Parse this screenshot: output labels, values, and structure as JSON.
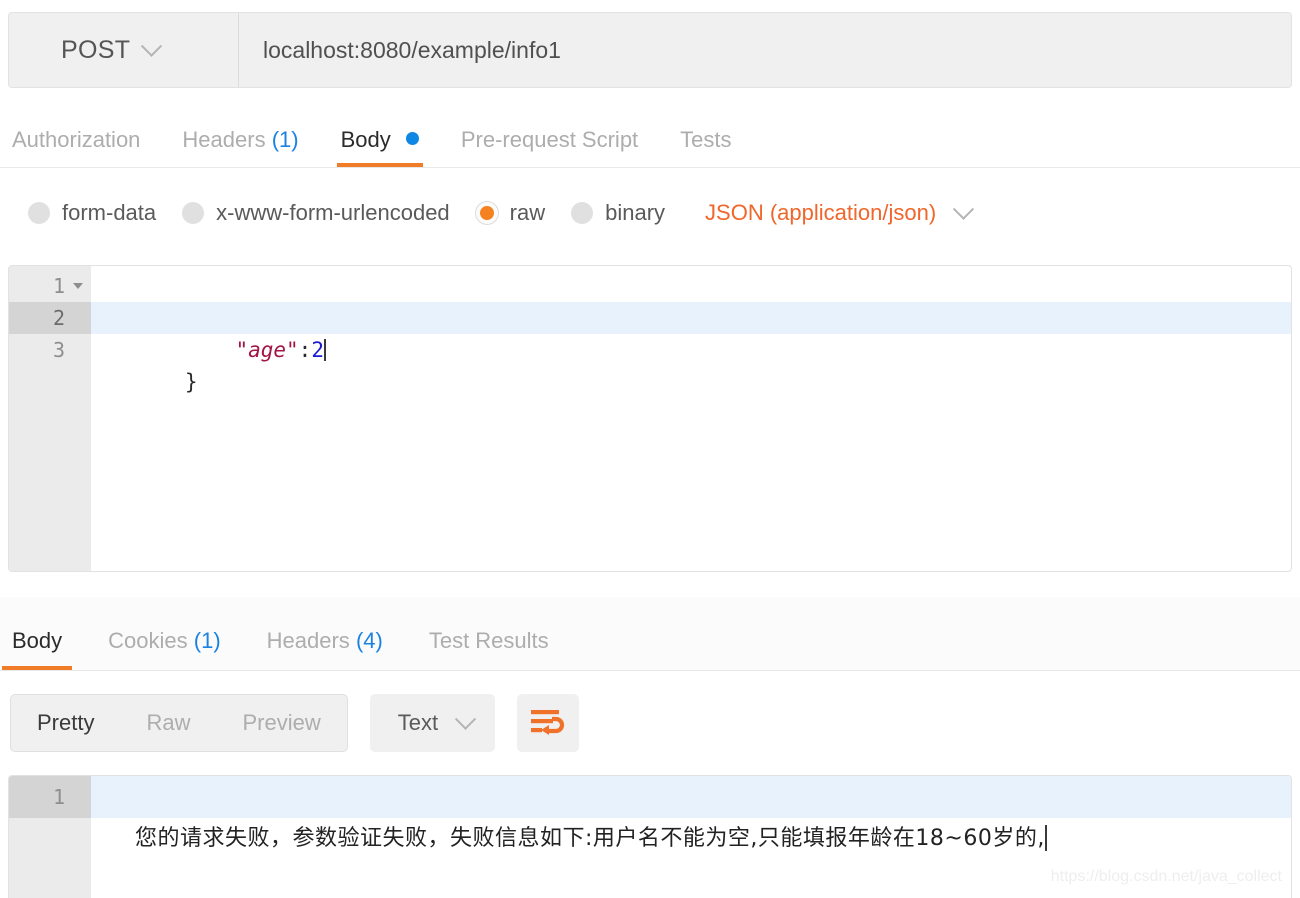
{
  "request": {
    "method": "POST",
    "method_caret_icon": "chevron-down-icon",
    "url": "localhost:8080/example/info1",
    "tabs": [
      {
        "label": "Authorization",
        "count": "",
        "active": false,
        "dot": false
      },
      {
        "label": "Headers",
        "count": "(1)",
        "active": false,
        "dot": false
      },
      {
        "label": "Body",
        "count": "",
        "active": true,
        "dot": true
      },
      {
        "label": "Pre-request Script",
        "count": "",
        "active": false,
        "dot": false
      },
      {
        "label": "Tests",
        "count": "",
        "active": false,
        "dot": false
      }
    ],
    "body_modes": [
      {
        "label": "form-data",
        "selected": false
      },
      {
        "label": "x-www-form-urlencoded",
        "selected": false
      },
      {
        "label": "raw",
        "selected": true
      },
      {
        "label": "binary",
        "selected": false
      }
    ],
    "content_type": "JSON (application/json)",
    "content_type_caret_icon": "chevron-down-icon",
    "editor": {
      "lines": [
        {
          "number": "1",
          "indent": "",
          "text": "{",
          "fold": true,
          "active": false
        },
        {
          "number": "2",
          "indent": "    ",
          "key": "\"age\"",
          "colon": ":",
          "value": "2",
          "active": true,
          "fold": false
        },
        {
          "number": "3",
          "indent": "",
          "text": "}",
          "fold": false,
          "active": false
        }
      ]
    }
  },
  "response": {
    "tabs": [
      {
        "label": "Body",
        "count": "",
        "active": true
      },
      {
        "label": "Cookies",
        "count": "(1)",
        "active": false
      },
      {
        "label": "Headers",
        "count": "(4)",
        "active": false
      },
      {
        "label": "Test Results",
        "count": "",
        "active": false
      }
    ],
    "view_modes": [
      {
        "label": "Pretty",
        "active": true
      },
      {
        "label": "Raw",
        "active": false
      },
      {
        "label": "Preview",
        "active": false
      }
    ],
    "format": "Text",
    "format_caret_icon": "chevron-down-icon",
    "wrap_button_icon": "word-wrap-icon",
    "body": {
      "line_number": "1",
      "text": "您的请求失败，参数验证失败，失败信息如下:用户名不能为空,只能填报年龄在18~60岁的,"
    }
  },
  "watermark": "https://blog.csdn.net/java_collect",
  "colors": {
    "accent_orange": "#f07c27",
    "content_type_orange": "#f0662b",
    "radio_orange": "#f58220",
    "count_blue": "#1a82e2",
    "dot_blue": "#0f88e5",
    "active_line_blue": "#e8f2fd",
    "json_key": "#a31545",
    "json_number": "#1a1ad1"
  }
}
